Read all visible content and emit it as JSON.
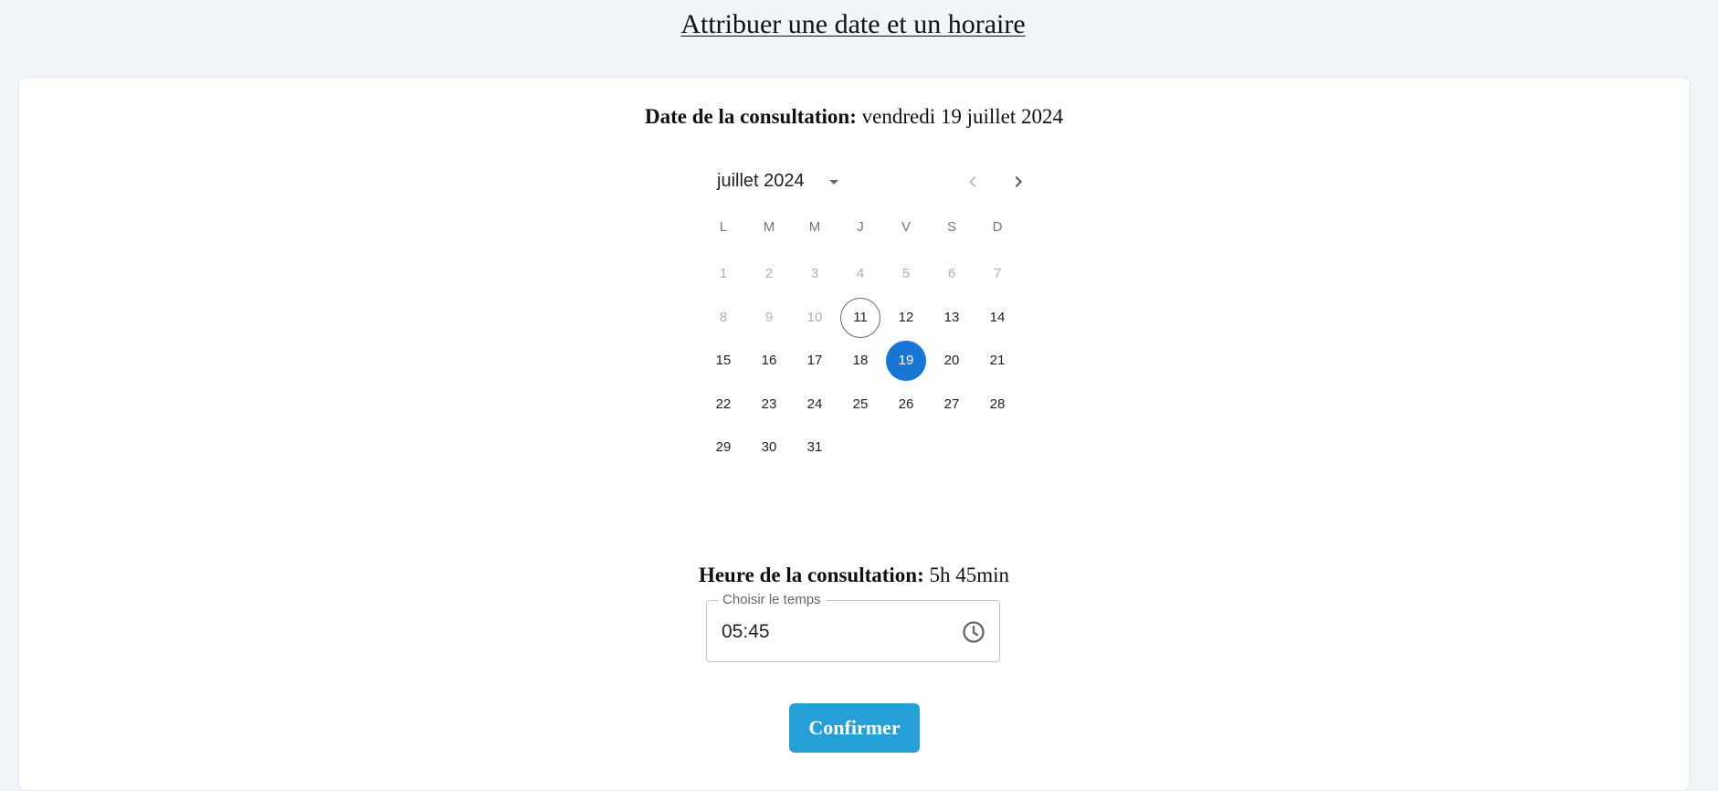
{
  "page": {
    "title": "Attribuer une date et un horaire"
  },
  "date_section": {
    "label": "Date de la consultation:",
    "value": "vendredi 19 juillet 2024"
  },
  "calendar": {
    "month_label": "juillet 2024",
    "icons": {
      "dropdown": "caret-down-icon",
      "prev": "chevron-left-icon",
      "next": "chevron-right-icon"
    },
    "weekdays": [
      "L",
      "M",
      "M",
      "J",
      "V",
      "S",
      "D"
    ],
    "days": [
      {
        "label": "1",
        "state": "disabled"
      },
      {
        "label": "2",
        "state": "disabled"
      },
      {
        "label": "3",
        "state": "disabled"
      },
      {
        "label": "4",
        "state": "disabled"
      },
      {
        "label": "5",
        "state": "disabled"
      },
      {
        "label": "6",
        "state": "disabled"
      },
      {
        "label": "7",
        "state": "disabled"
      },
      {
        "label": "8",
        "state": "disabled"
      },
      {
        "label": "9",
        "state": "disabled"
      },
      {
        "label": "10",
        "state": "disabled"
      },
      {
        "label": "11",
        "state": "today"
      },
      {
        "label": "12",
        "state": "normal"
      },
      {
        "label": "13",
        "state": "normal"
      },
      {
        "label": "14",
        "state": "normal"
      },
      {
        "label": "15",
        "state": "normal"
      },
      {
        "label": "16",
        "state": "normal"
      },
      {
        "label": "17",
        "state": "normal"
      },
      {
        "label": "18",
        "state": "normal"
      },
      {
        "label": "19",
        "state": "selected"
      },
      {
        "label": "20",
        "state": "normal"
      },
      {
        "label": "21",
        "state": "normal"
      },
      {
        "label": "22",
        "state": "normal"
      },
      {
        "label": "23",
        "state": "normal"
      },
      {
        "label": "24",
        "state": "normal"
      },
      {
        "label": "25",
        "state": "normal"
      },
      {
        "label": "26",
        "state": "normal"
      },
      {
        "label": "27",
        "state": "normal"
      },
      {
        "label": "28",
        "state": "normal"
      },
      {
        "label": "29",
        "state": "normal"
      },
      {
        "label": "30",
        "state": "normal"
      },
      {
        "label": "31",
        "state": "normal"
      }
    ],
    "colors": {
      "selected": "#1976d2",
      "disabled_text": "#b0b0b0"
    }
  },
  "time_section": {
    "label": "Heure de la consultation:",
    "value": "5h 45min",
    "field_legend": "Choisir le temps",
    "field_value": "05:45",
    "clock_icon": "clock-icon"
  },
  "actions": {
    "confirm_label": "Confirmer",
    "confirm_color": "#24a0d6"
  }
}
